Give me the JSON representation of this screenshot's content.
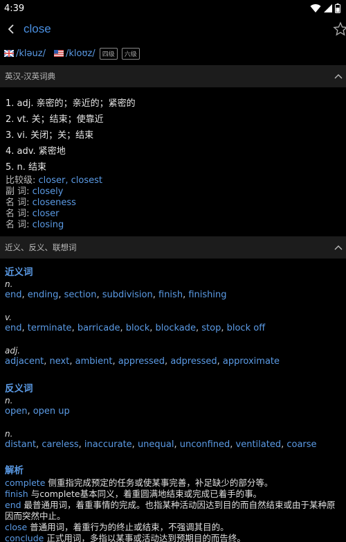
{
  "status": {
    "time": "4:39"
  },
  "header": {
    "title": "close"
  },
  "phonetics": {
    "uk": "/kləuz/",
    "us": "/kloʊz/",
    "badges": [
      "四级",
      "六级"
    ]
  },
  "sections": {
    "dict_title": "英汉-汉英词典",
    "related_title": "近义、反义、联想词"
  },
  "definitions": [
    "1. adj. 亲密的；亲近的；紧密的",
    "2. vt. 关；结束；使靠近",
    "3. vi. 关闭；关；结束",
    "4. adv. 紧密地",
    "5. n. 结束"
  ],
  "forms": [
    {
      "label": "比较级:",
      "value": "closer, closest"
    },
    {
      "label": "副 词:",
      "value": "closely"
    },
    {
      "label": "名 词:",
      "value": "closeness"
    },
    {
      "label": "名 词:",
      "value": "closer"
    },
    {
      "label": "名 词:",
      "value": "closing"
    }
  ],
  "synonyms": {
    "title": "近义词",
    "groups": [
      {
        "pos": "n.",
        "words": [
          "end",
          "ending",
          "section",
          "subdivision",
          "finish",
          "finishing"
        ]
      },
      {
        "pos": "v.",
        "words": [
          "end",
          "terminate",
          "barricade",
          "block",
          "blockade",
          "stop",
          "block off"
        ]
      },
      {
        "pos": "adj.",
        "words": [
          "adjacent",
          "next",
          "ambient",
          "appressed",
          "adpressed",
          "approximate"
        ]
      }
    ]
  },
  "antonyms": {
    "title": "反义词",
    "groups": [
      {
        "pos": "n.",
        "words": [
          "open",
          "open up"
        ]
      },
      {
        "pos": "n.",
        "words": [
          "distant",
          "careless",
          "inaccurate",
          "unequal",
          "unconfined",
          "ventilated",
          "coarse"
        ]
      }
    ]
  },
  "analysis": {
    "title": "解析",
    "lines": [
      {
        "word": "complete",
        "text": " 侧重指完成预定的任务或使某事完善，补足缺少的部分等。"
      },
      {
        "word": "finish",
        "text": " 与complete基本同义，着重圆满地结束或完成已着手的事。"
      },
      {
        "word": "end",
        "text": " 最普通用词，着重事情的完成。也指某种活动因达到目的而自然结束或由于某种原因而突然中止。"
      },
      {
        "word": "close",
        "text": " 普通用词，着重行为的终止或结束，不强调其目的。"
      },
      {
        "word": "conclude",
        "text": " 正式用词，多指以某事或活动达到预期目的而告终。"
      }
    ]
  },
  "colors": {
    "accent": "#4a90e2",
    "background": "#000000",
    "section_bg": "#1c1c1c"
  }
}
